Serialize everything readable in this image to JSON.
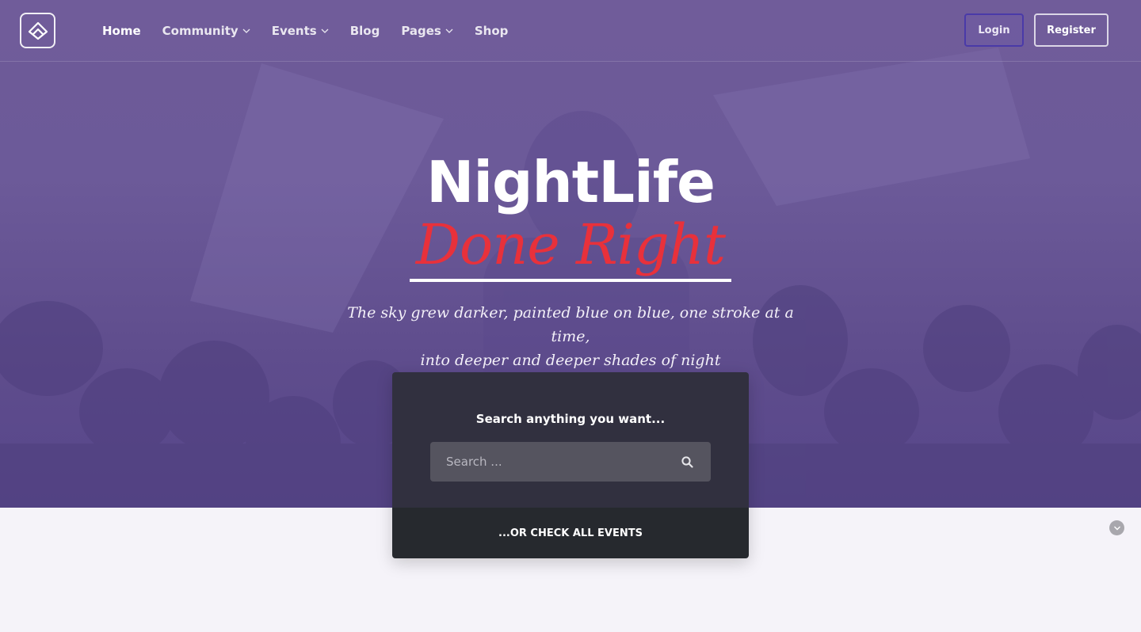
{
  "brand": {
    "logo_icon": "chevron-up-diamond-icon"
  },
  "nav": {
    "items": [
      {
        "label": "Home",
        "active": true,
        "has_dropdown": false
      },
      {
        "label": "Community",
        "active": false,
        "has_dropdown": true
      },
      {
        "label": "Events",
        "active": false,
        "has_dropdown": true
      },
      {
        "label": "Blog",
        "active": false,
        "has_dropdown": false
      },
      {
        "label": "Pages",
        "active": false,
        "has_dropdown": true
      },
      {
        "label": "Shop",
        "active": false,
        "has_dropdown": false
      }
    ],
    "login_label": "Login",
    "register_label": "Register"
  },
  "hero": {
    "title_line1": "NightLife",
    "title_line2": "Done Right",
    "subtitle_line1": "The sky grew darker, painted blue on blue, one stroke at a time,",
    "subtitle_line2": "into deeper and deeper shades of night"
  },
  "search": {
    "heading": "Search anything you want...",
    "placeholder": "Search ...",
    "icon": "search-icon",
    "cta_label": "...OR CHECK ALL EVENTS"
  },
  "colors": {
    "hero_overlay": "#6c5a99",
    "accent_red": "#e8313b",
    "card_top": "#31303f",
    "card_bottom": "#26292e",
    "page_background": "#f5f3f9"
  }
}
